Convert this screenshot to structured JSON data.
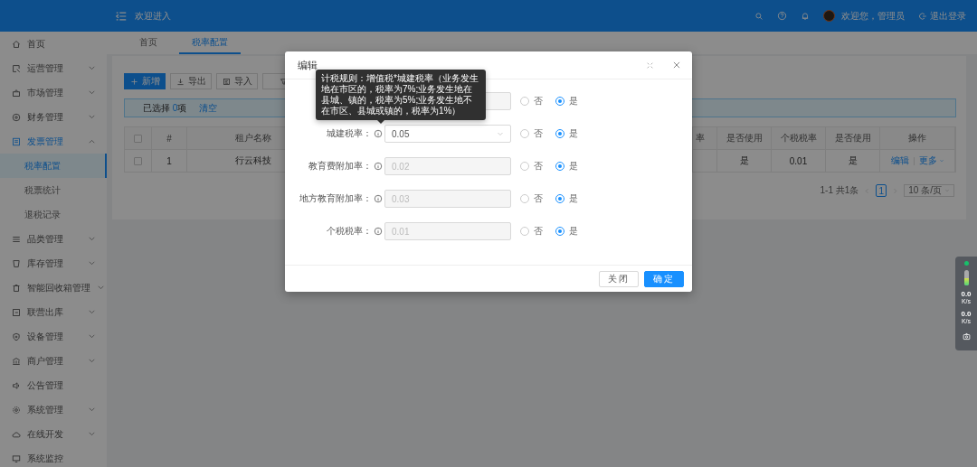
{
  "header": {
    "greeting": "欢迎进入",
    "user": "欢迎您，管理员",
    "logout": "退出登录"
  },
  "sidebar": {
    "items": [
      {
        "label": "首页",
        "selected": false
      },
      {
        "label": "运营管理",
        "selected": false,
        "expanded": false
      },
      {
        "label": "市场管理",
        "selected": false,
        "expanded": false
      },
      {
        "label": "财务管理",
        "selected": false,
        "expanded": false
      },
      {
        "label": "发票管理",
        "selected": true,
        "expanded": true,
        "children": [
          {
            "label": "税率配置",
            "selected": true
          },
          {
            "label": "税票统计",
            "selected": false
          },
          {
            "label": "退税记录",
            "selected": false
          }
        ]
      },
      {
        "label": "品类管理",
        "selected": false,
        "expanded": false
      },
      {
        "label": "库存管理",
        "selected": false,
        "expanded": false
      },
      {
        "label": "智能回收箱管理",
        "selected": false,
        "expanded": false
      },
      {
        "label": "联营出库",
        "selected": false,
        "expanded": false
      },
      {
        "label": "设备管理",
        "selected": false,
        "expanded": false
      },
      {
        "label": "商户管理",
        "selected": false,
        "expanded": false
      },
      {
        "label": "公告管理",
        "selected": false
      },
      {
        "label": "系统管理",
        "selected": false,
        "expanded": false
      },
      {
        "label": "在线开发",
        "selected": false,
        "expanded": false
      },
      {
        "label": "系统监控",
        "selected": false
      }
    ]
  },
  "tabs": [
    {
      "label": "首页",
      "selected": false
    },
    {
      "label": "税率配置",
      "selected": true
    }
  ],
  "toolbar": [
    {
      "kind": "primary",
      "label": "新增"
    },
    {
      "kind": "export",
      "label": "导出"
    },
    {
      "kind": "import",
      "label": "导入"
    },
    {
      "kind": "filter"
    }
  ],
  "selection_alert": {
    "prefix": "已选择",
    "count": "0",
    "suffix": "项",
    "clear": "清空"
  },
  "table": {
    "select_all": {
      "checked": false
    },
    "columns": [
      {
        "kind": "text",
        "label": "#"
      },
      {
        "kind": "text",
        "label": "租户名称"
      },
      {
        "kind": "cut",
        "label": "率"
      },
      {
        "kind": "text",
        "label": "是否使用"
      },
      {
        "kind": "text",
        "label": "个税税率"
      },
      {
        "kind": "text",
        "label": "是否使用"
      },
      {
        "kind": "actions",
        "label": "操作"
      }
    ],
    "rows": [
      {
        "checked": false,
        "cells": [
          "1",
          "行云科技",
          null,
          "是",
          "0.01",
          "是"
        ],
        "actions": [
          "编辑",
          "更多"
        ]
      }
    ]
  },
  "pagination": {
    "total": "1-1 共1条",
    "pages": [
      {
        "label": "1",
        "selected": true
      }
    ],
    "page_size": "10 条/页"
  },
  "modal": {
    "title": "编辑",
    "tooltip": "计税规则：增值税*城建税率（业务发生地在市区的，税率为7%;业务发生地在县城、镇的，税率为5%;业务发生地不在市区、县城或镇的，税率为1%）",
    "fields": [
      {
        "kind": "input",
        "disabled": true,
        "options": [
          {
            "label": "否",
            "selected": false
          },
          {
            "label": "是",
            "selected": true
          }
        ]
      },
      {
        "kind": "select",
        "label": "城建税率：",
        "value": "0.05",
        "disabled": false,
        "options": [
          {
            "label": "否",
            "selected": false
          },
          {
            "label": "是",
            "selected": true
          }
        ]
      },
      {
        "kind": "input",
        "label": "教育费附加率：",
        "value": "0.02",
        "disabled": true,
        "options": [
          {
            "label": "否",
            "selected": false
          },
          {
            "label": "是",
            "selected": true
          }
        ]
      },
      {
        "kind": "input",
        "label": "地方教育附加率：",
        "value": "0.03",
        "disabled": true,
        "options": [
          {
            "label": "否",
            "selected": false
          },
          {
            "label": "是",
            "selected": true
          }
        ]
      },
      {
        "kind": "input",
        "label": "个税税率：",
        "value": "0.01",
        "disabled": true,
        "options": [
          {
            "label": "否",
            "selected": false
          },
          {
            "label": "是",
            "selected": true
          }
        ]
      }
    ],
    "buttons": [
      {
        "kind": "default",
        "label": "关闭"
      },
      {
        "kind": "primary",
        "label": "确定"
      }
    ]
  },
  "monitor": {
    "upload": "0.0",
    "upload_unit": "K/s",
    "download": "0.0",
    "download_unit": "K/s"
  }
}
